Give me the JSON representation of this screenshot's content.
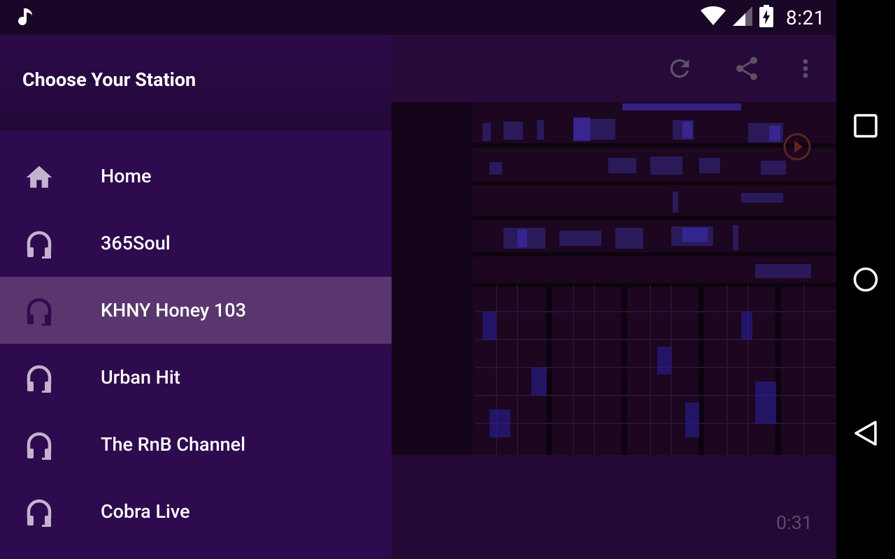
{
  "status_bar": {
    "time": "8:21",
    "left_icon": "music-note-icon",
    "right_icons": [
      "wifi-icon",
      "cell-signal-icon",
      "battery-charging-icon"
    ]
  },
  "toolbar": {
    "icons": [
      "refresh-icon",
      "share-icon",
      "more-vert-icon"
    ]
  },
  "drawer": {
    "title": "Choose Your Station",
    "items": [
      {
        "label": "Home",
        "icon": "home-icon",
        "selected": false
      },
      {
        "label": "365Soul",
        "icon": "headphones-icon",
        "selected": false
      },
      {
        "label": "KHNY Honey 103",
        "icon": "headphones-icon",
        "selected": true
      },
      {
        "label": "Urban Hit",
        "icon": "headphones-icon",
        "selected": false
      },
      {
        "label": "The RnB Channel",
        "icon": "headphones-icon",
        "selected": false
      },
      {
        "label": "Cobra Live",
        "icon": "headphones-icon",
        "selected": false
      }
    ]
  },
  "player": {
    "elapsed": "0:31"
  },
  "navigation_bar": {
    "buttons": [
      "recents-icon",
      "home-circle-icon",
      "back-icon"
    ]
  },
  "colors": {
    "drawer_bg": "#2e0a4e",
    "selected_bg": "#5a366e",
    "icon_tint": "#c4b3cf",
    "status_bg": "#1a0626"
  }
}
